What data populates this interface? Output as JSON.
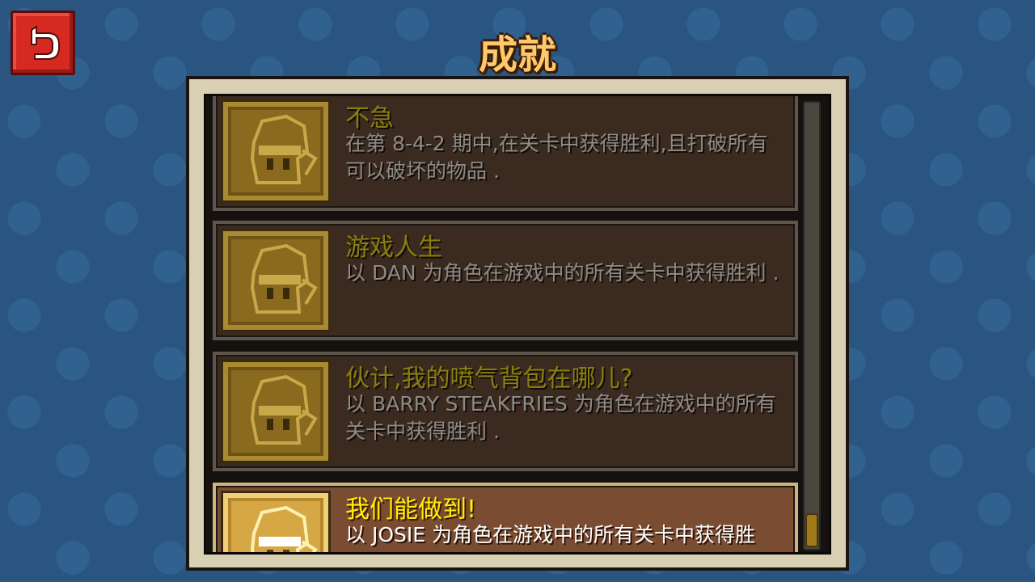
{
  "header": {
    "title": "成就"
  },
  "achievements": [
    {
      "title": "不急",
      "desc": "在第 8-4-2 期中,在关卡中获得胜利,且打破所有可以破坏的物品 .",
      "unlocked": false
    },
    {
      "title": "游戏人生",
      "desc": "以 DAN 为角色在游戏中的所有关卡中获得胜利 .",
      "unlocked": false
    },
    {
      "title": "伙计,我的喷气背包在哪儿?",
      "desc": "以 BARRY STEAKFRIES 为角色在游戏中的所有关卡中获得胜利 .",
      "unlocked": false
    },
    {
      "title": "我们能做到!",
      "desc": "以 JOSIE 为角色在游戏中的所有关卡中获得胜",
      "unlocked": true
    }
  ],
  "colors": {
    "locked_title": "#8a7f0c",
    "unlocked_title": "#fff200",
    "back_button": "#d42a22"
  },
  "icons": {
    "back": "undo-arrow-icon",
    "badge": "hero-head-icon"
  }
}
